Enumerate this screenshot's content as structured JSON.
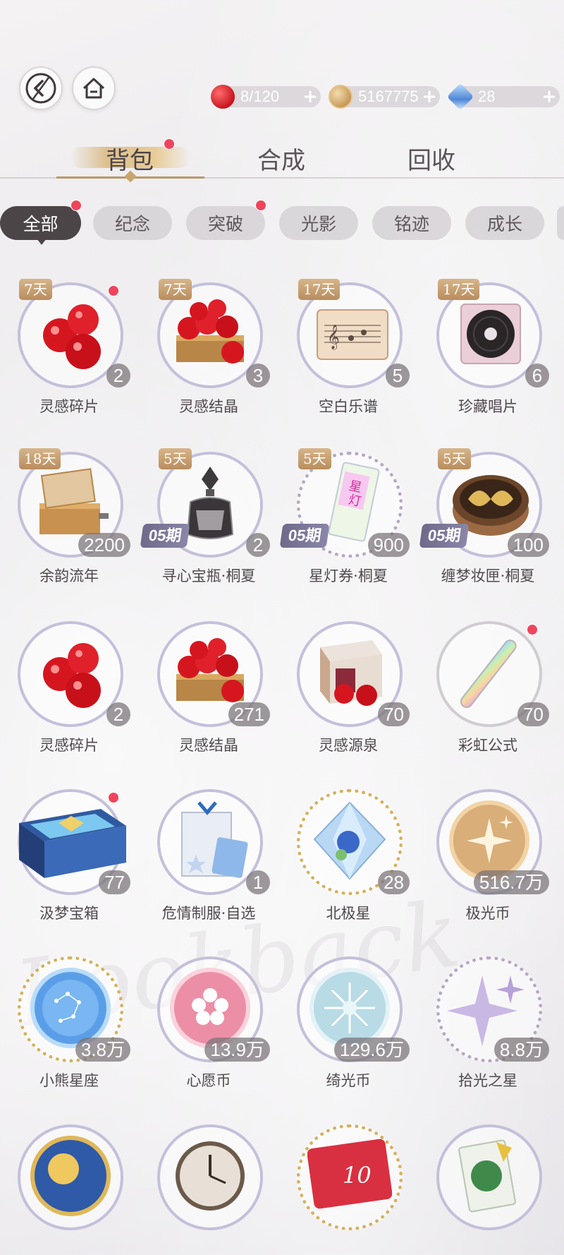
{
  "header": {
    "back_icon": "back-arrow-icon",
    "home_icon": "home-icon",
    "resources": [
      {
        "icon": "apple-icon",
        "value": "8/120",
        "plus": "+"
      },
      {
        "icon": "gold-coin-icon",
        "value": "5167775",
        "plus": "+"
      },
      {
        "icon": "diamond-icon",
        "value": "28",
        "plus": "+"
      }
    ]
  },
  "main_tabs": [
    "背包",
    "合成",
    "回收"
  ],
  "sub_tabs": [
    "全部",
    "纪念",
    "突破",
    "光影",
    "铭迹",
    "成长"
  ],
  "items": [
    {
      "name": "灵感碎片",
      "days": "7天",
      "count": "2",
      "icon": "apples-icon",
      "dot": true
    },
    {
      "name": "灵感结晶",
      "days": "7天",
      "count": "3",
      "icon": "apple-crate-icon"
    },
    {
      "name": "空白乐谱",
      "days": "17天",
      "count": "5",
      "icon": "music-sheet-icon"
    },
    {
      "name": "珍藏唱片",
      "days": "17天",
      "count": "6",
      "icon": "vinyl-record-icon"
    },
    {
      "name": "余韵流年",
      "days": "18天",
      "count": "2200",
      "icon": "music-box-icon"
    },
    {
      "name": "寻心宝瓶·桐夏",
      "days": "5天",
      "count": "2",
      "icon": "perfume-bottle-icon",
      "event": "05"
    },
    {
      "name": "星灯券·桐夏",
      "days": "5天",
      "count": "900",
      "icon": "star-lamp-ticket-icon",
      "event": "05"
    },
    {
      "name": "缠梦妆匣·桐夏",
      "days": "5天",
      "count": "100",
      "icon": "vanity-box-icon",
      "event": "05"
    },
    {
      "name": "灵感碎片",
      "count": "2",
      "icon": "apples-icon"
    },
    {
      "name": "灵感结晶",
      "count": "271",
      "icon": "apple-crate-icon"
    },
    {
      "name": "灵感源泉",
      "count": "70",
      "icon": "apple-box-icon"
    },
    {
      "name": "彩虹公式",
      "count": "70",
      "icon": "rainbow-tube-icon",
      "dot": true
    },
    {
      "name": "汲梦宝箱",
      "count": "77",
      "icon": "dream-chest-icon",
      "dot": true
    },
    {
      "name": "危情制服·自选",
      "count": "1",
      "icon": "uniform-package-icon"
    },
    {
      "name": "北极星",
      "count": "28",
      "icon": "crystal-icon"
    },
    {
      "name": "极光币",
      "count": "516.7万",
      "icon": "aurora-coin-icon"
    },
    {
      "name": "小熊星座",
      "count": "3.8万",
      "icon": "ursa-coin-icon"
    },
    {
      "name": "心愿币",
      "count": "13.9万",
      "icon": "wish-coin-icon"
    },
    {
      "name": "绮光币",
      "count": "129.6万",
      "icon": "radiance-coin-icon"
    },
    {
      "name": "拾光之星",
      "count": "8.8万",
      "icon": "sparkle-star-icon"
    },
    {
      "name": "",
      "count": "",
      "icon": "sun-compass-icon"
    },
    {
      "name": "",
      "count": "",
      "icon": "clock-icon"
    },
    {
      "name": "",
      "count": "",
      "icon": "red-card-icon"
    },
    {
      "name": "",
      "count": "",
      "icon": "plant-card-icon"
    }
  ],
  "event_tag_text": "05期",
  "colors": {
    "accent": "#f0445d",
    "gold": "#c9a66b",
    "active_tab": "#4c4548"
  }
}
